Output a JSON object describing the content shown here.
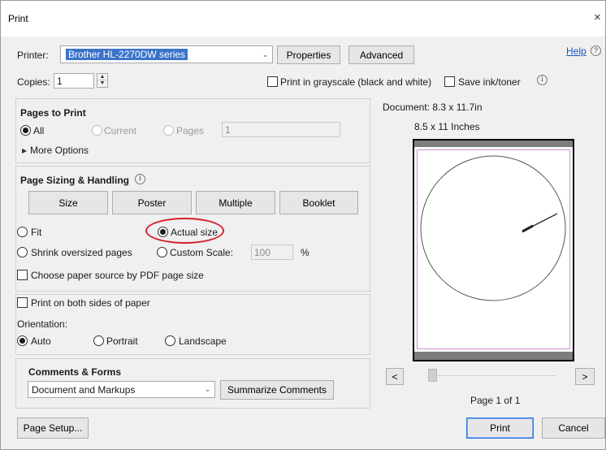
{
  "window": {
    "title": "Print",
    "close_glyph": "×"
  },
  "printer": {
    "label": "Printer:",
    "selected": "Brother HL-2270DW series",
    "properties_label": "Properties",
    "advanced_label": "Advanced",
    "help_label": "Help",
    "help_icon": "question-circle-icon"
  },
  "copies": {
    "label": "Copies:",
    "value": "1",
    "grayscale_label": "Print in grayscale (black and white)",
    "grayscale_checked": false,
    "save_ink_label": "Save ink/toner",
    "save_ink_checked": false
  },
  "pages_to_print": {
    "title": "Pages to Print",
    "options": [
      "All",
      "Current",
      "Pages"
    ],
    "selected": "All",
    "pages_value": "1",
    "more_options_label": "More Options"
  },
  "sizing": {
    "title": "Page Sizing & Handling",
    "tabs": [
      "Size",
      "Poster",
      "Multiple",
      "Booklet"
    ],
    "fit_label": "Fit",
    "actual_size_label": "Actual size",
    "shrink_label": "Shrink oversized pages",
    "custom_scale_label": "Custom Scale:",
    "custom_scale_value": "100",
    "percent_sign": "%",
    "selected": "Actual size",
    "choose_source_label": "Choose paper source by PDF page size",
    "choose_source_checked": false
  },
  "duplex": {
    "both_sides_label": "Print on both sides of paper",
    "both_sides_checked": false
  },
  "orientation": {
    "label": "Orientation:",
    "options": [
      "Auto",
      "Portrait",
      "Landscape"
    ],
    "selected": "Auto"
  },
  "comments": {
    "title": "Comments & Forms",
    "selected": "Document and Markups",
    "summarize_label": "Summarize Comments"
  },
  "preview": {
    "document_size": "Document: 8.3 x 11.7in",
    "paper_size": "8.5 x 11 Inches",
    "prev_glyph": "<",
    "next_glyph": ">",
    "page_indicator": "Page 1 of 1",
    "slider_position": 0.0
  },
  "footer": {
    "page_setup_label": "Page Setup...",
    "print_label": "Print",
    "cancel_label": "Cancel"
  },
  "colors": {
    "accent": "#3b73c8",
    "highlight_annotation": "#d8202a",
    "margin_outline": "#d08ad8"
  }
}
